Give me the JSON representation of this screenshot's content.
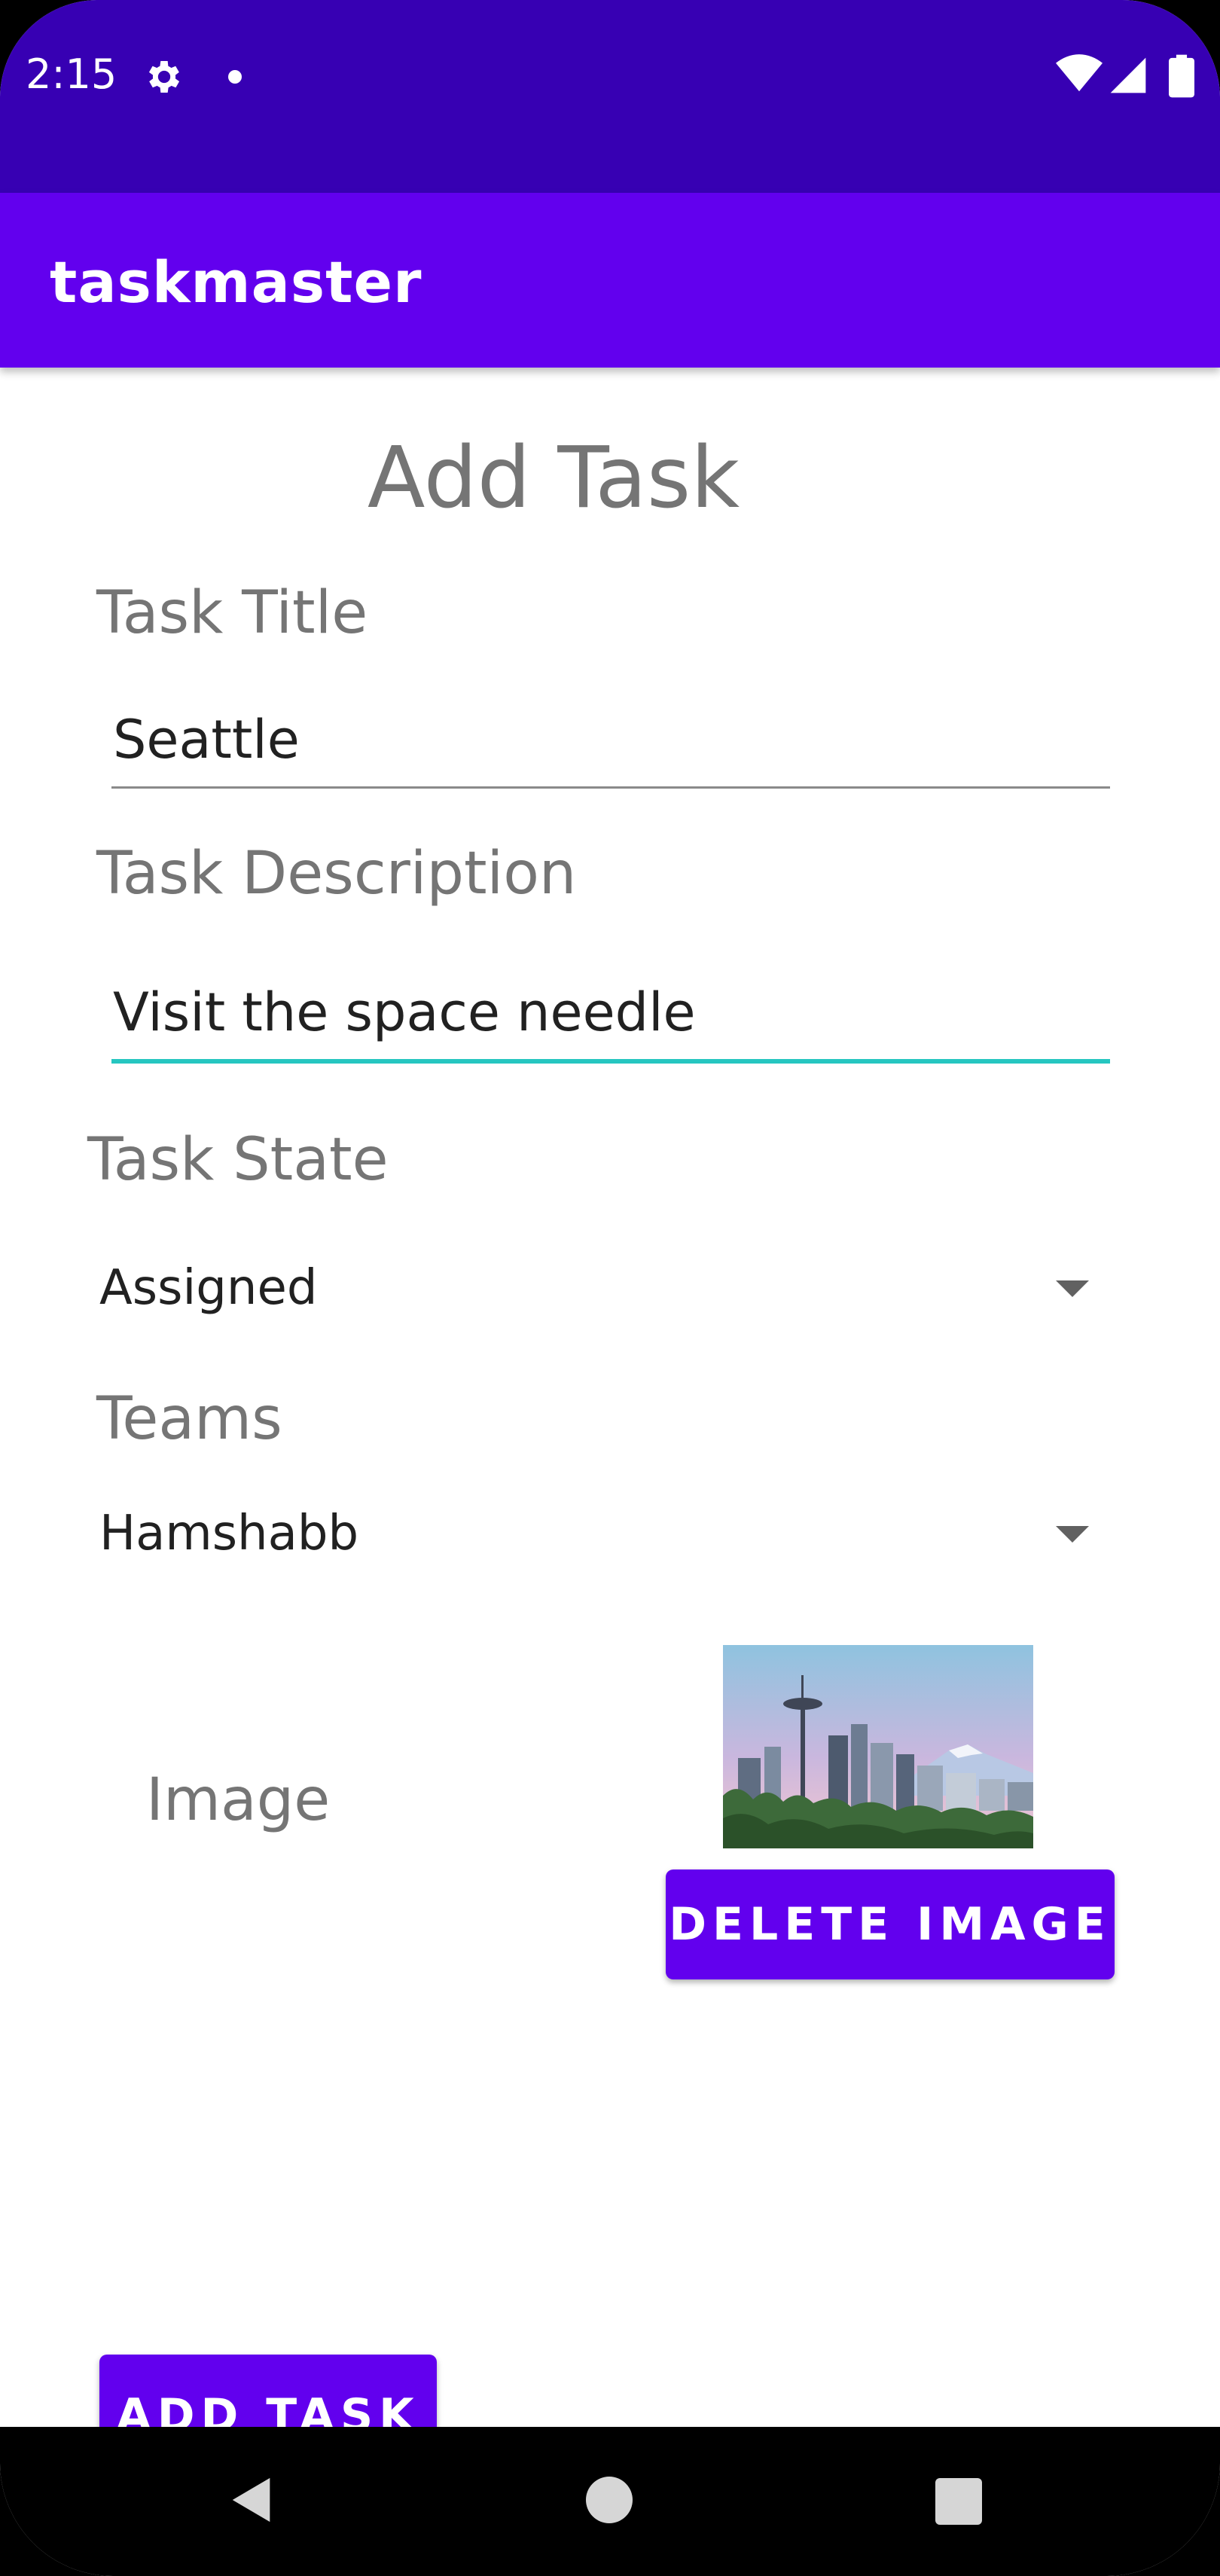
{
  "status_bar": {
    "time": "2:15"
  },
  "app_bar": {
    "title": "taskmaster"
  },
  "page": {
    "title": "Add Task"
  },
  "form": {
    "task_title": {
      "label": "Task Title",
      "value": "Seattle"
    },
    "task_description": {
      "label": "Task Description",
      "value": "Visit the space needle"
    },
    "task_state": {
      "label": "Task State",
      "selected": "Assigned"
    },
    "teams": {
      "label": "Teams",
      "selected": "Hamshabb"
    },
    "image": {
      "label": "Image",
      "delete_label": "DELETE IMAGE"
    },
    "submit_label": "ADD TASK"
  },
  "colors": {
    "status_bar": "#3700b3",
    "primary": "#6200ee",
    "accent_underline": "#26c6c0",
    "label_gray": "#757575"
  },
  "icons": [
    "settings-gear-icon",
    "notification-dot-icon",
    "wifi-icon",
    "signal-icon",
    "battery-icon",
    "back-icon",
    "home-icon",
    "recents-icon",
    "dropdown-arrow-icon"
  ]
}
